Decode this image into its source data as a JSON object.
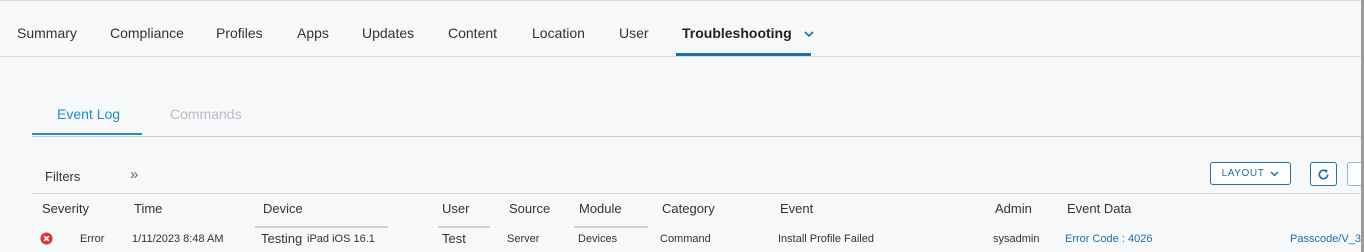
{
  "tabs": [
    "Summary",
    "Compliance",
    "Profiles",
    "Apps",
    "Updates",
    "Content",
    "Location",
    "User",
    "Troubleshooting"
  ],
  "subtabs": {
    "event_log": "Event Log",
    "commands": "Commands"
  },
  "toolbar": {
    "filters": "Filters",
    "expand_icon": "double-chevron-right-icon",
    "layout": "LAYOUT",
    "refresh_icon": "refresh-icon"
  },
  "columns": {
    "severity": "Severity",
    "time": "Time",
    "device": "Device",
    "user": "User",
    "source": "Source",
    "module": "Module",
    "category": "Category",
    "event": "Event",
    "admin": "Admin",
    "event_data": "Event Data"
  },
  "row": {
    "severity_icon": "error-circle-icon",
    "severity": "Error",
    "time": "1/11/2023 8:48 AM",
    "device_name": "Testing",
    "device_model": "iPad iOS 16.1",
    "user": "Test",
    "source": "Server",
    "module": "Devices",
    "category": "Command",
    "event": "Install Profile Failed",
    "admin": "sysadmin",
    "event_data": "Error Code : 4026",
    "extra_link": "Passcode/V_3"
  },
  "colors": {
    "accent": "#1f6fa8",
    "link": "#1e8ec8",
    "error": "#d9383a"
  }
}
